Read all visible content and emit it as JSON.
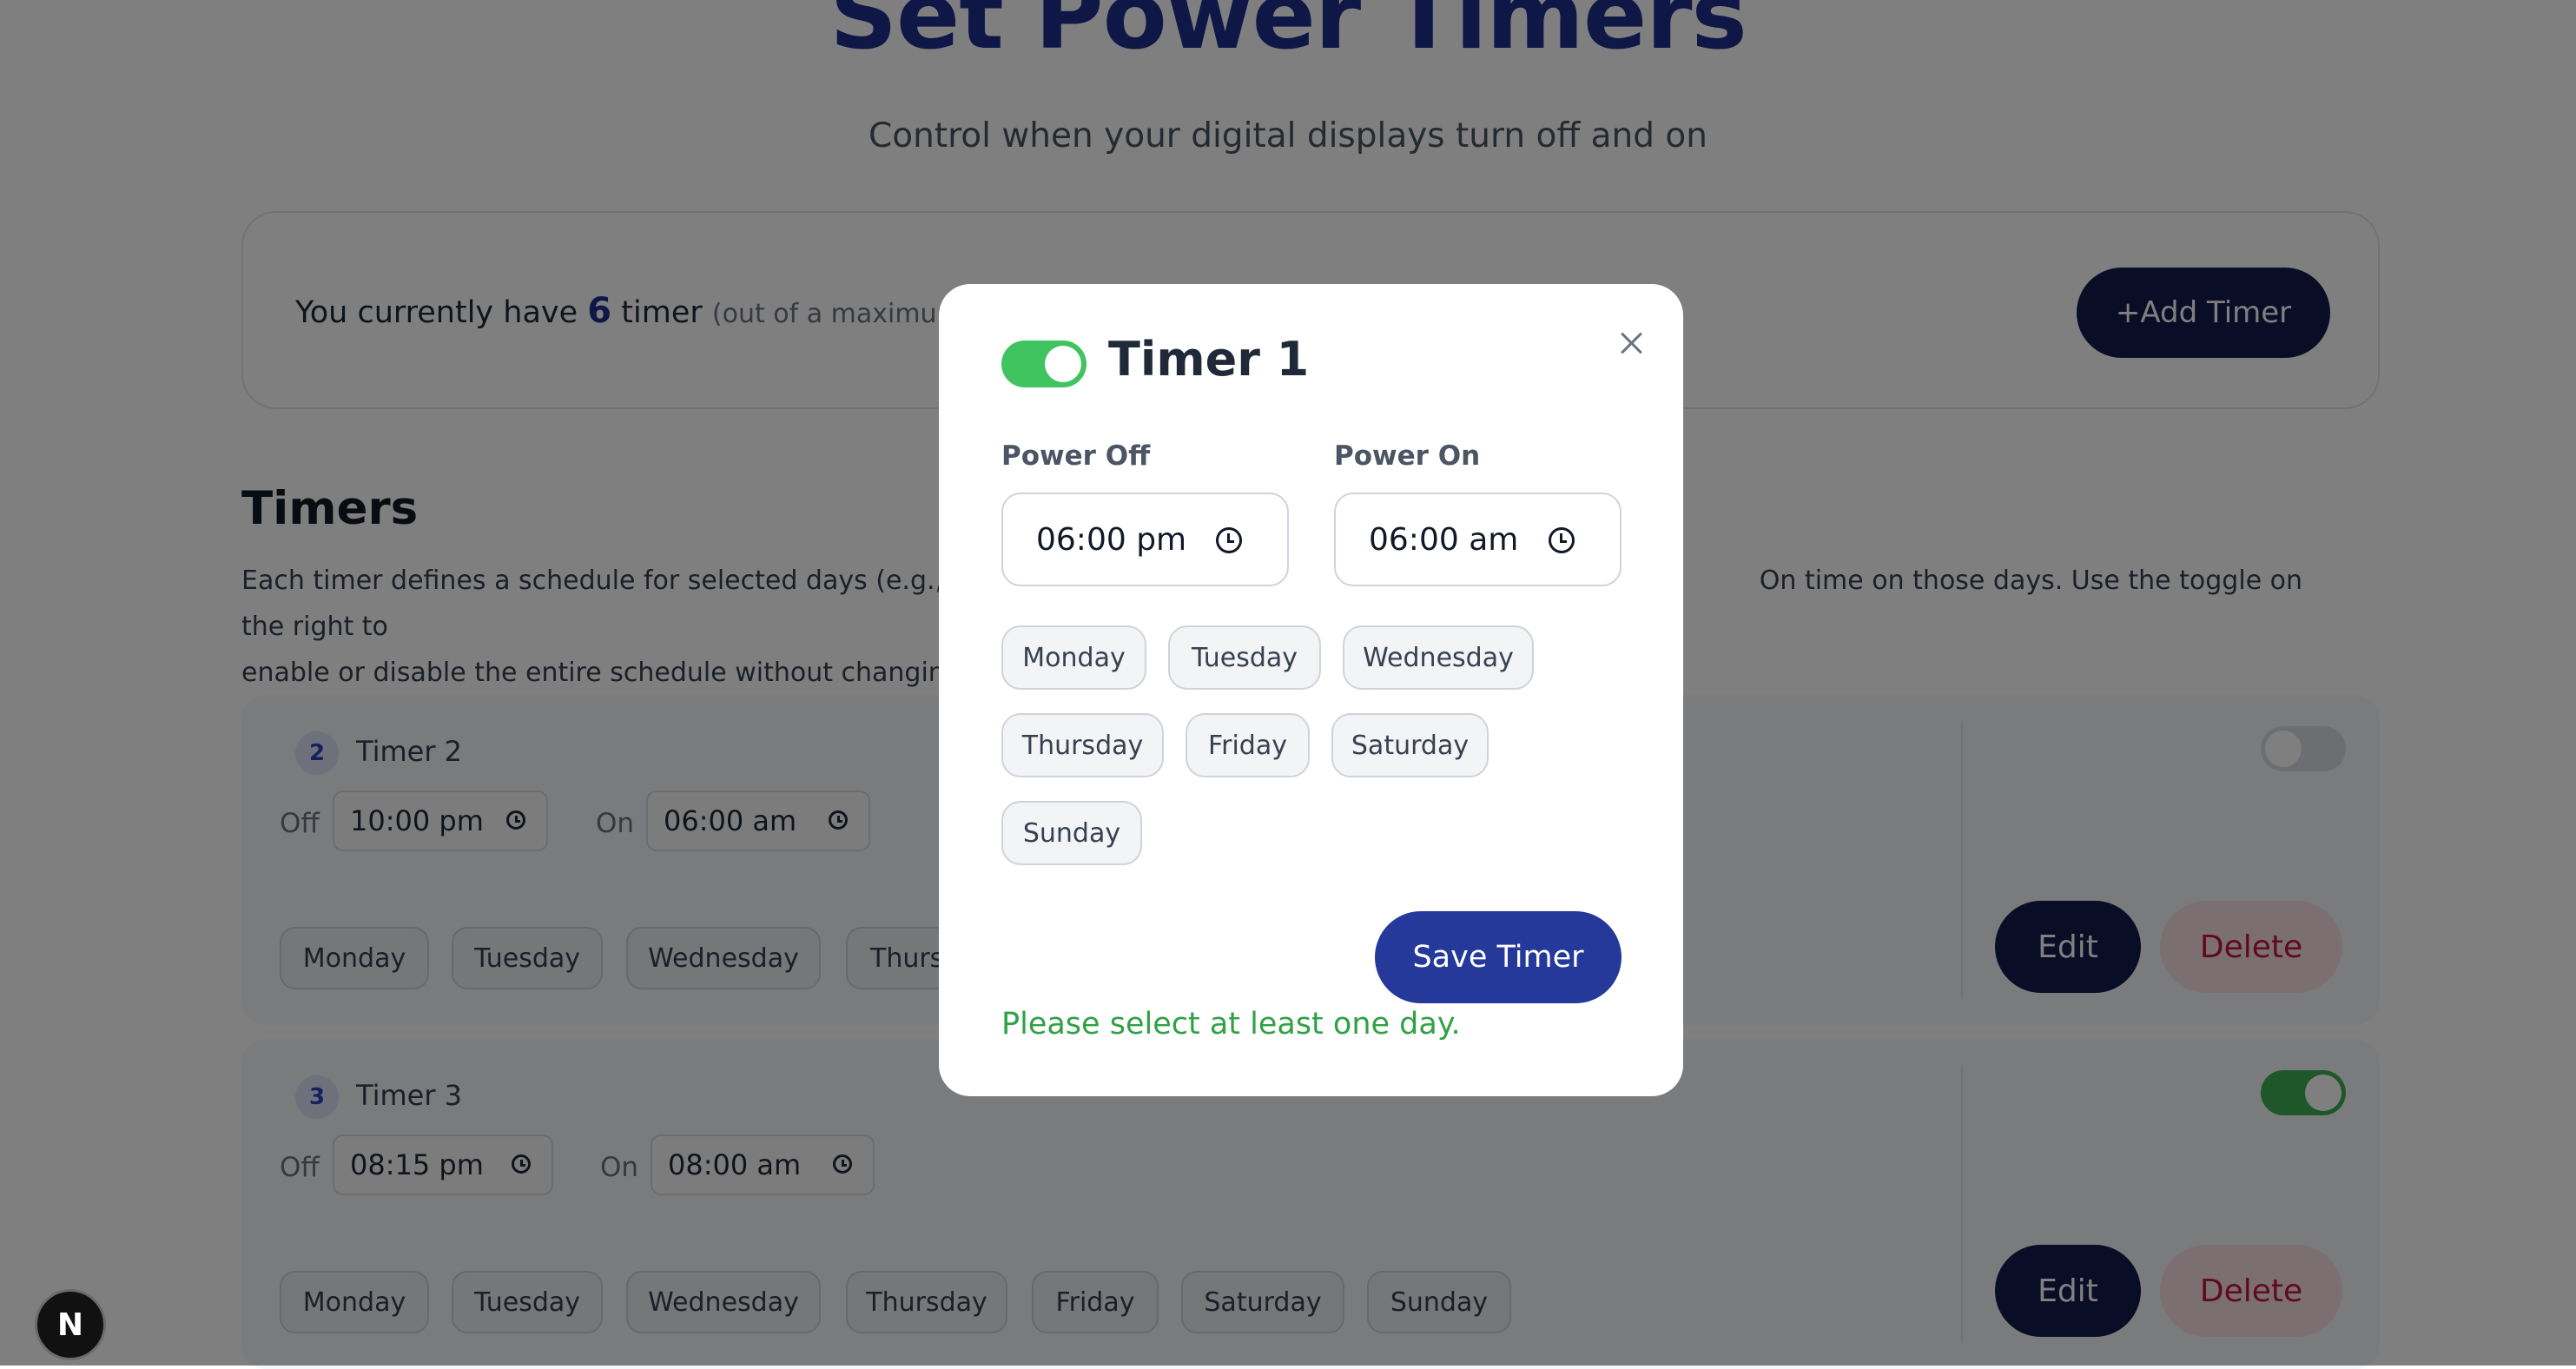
{
  "header": {
    "title": "Set Power Timers",
    "subtitle": "Control when your digital displays turn off and on"
  },
  "summary": {
    "prefix": "You currently have",
    "count": "6",
    "suffix": "timer",
    "note": "(out of a maximum of",
    "add_button": "+Add Timer"
  },
  "timers_section": {
    "title": "Timers",
    "desc_line1": "Each timer defines a schedule for selected days (e.g., Sun",
    "desc_line1_tail": "On  time on those days. Use the toggle on the right to",
    "desc_line2": "enable or disable the entire schedule without changing th"
  },
  "timer_cards": [
    {
      "number": "2",
      "name": "Timer 2",
      "off_label": "Off",
      "off_time": "10:00 pm",
      "on_label": "On",
      "on_time": "06:00 am",
      "days": [
        "Monday",
        "Tuesday",
        "Wednesday",
        "Thurs"
      ],
      "enabled": false,
      "edit_label": "Edit",
      "delete_label": "Delete"
    },
    {
      "number": "3",
      "name": "Timer 3",
      "off_label": "Off",
      "off_time": "08:15 pm",
      "on_label": "On",
      "on_time": "08:00 am",
      "days": [
        "Monday",
        "Tuesday",
        "Wednesday",
        "Thursday",
        "Friday",
        "Saturday",
        "Sunday"
      ],
      "enabled": true,
      "edit_label": "Edit",
      "delete_label": "Delete"
    }
  ],
  "modal": {
    "enabled": true,
    "title": "Timer 1",
    "power_off_label": "Power Off",
    "power_off_value": "06:00 pm",
    "power_on_label": "Power On",
    "power_on_value": "06:00 am",
    "days": [
      "Monday",
      "Tuesday",
      "Wednesday",
      "Thursday",
      "Friday",
      "Saturday",
      "Sunday"
    ],
    "save_label": "Save Timer",
    "message": "Please select at least one day.",
    "message_color": "#31a146"
  },
  "dev_badge": {
    "letter": "N"
  },
  "colors": {
    "brand_navy": "#141b4d",
    "title_blue": "#1e2f8f",
    "save_blue": "#24399a",
    "toggle_green": "#3fc45f",
    "delete_red": "#c0143c"
  }
}
